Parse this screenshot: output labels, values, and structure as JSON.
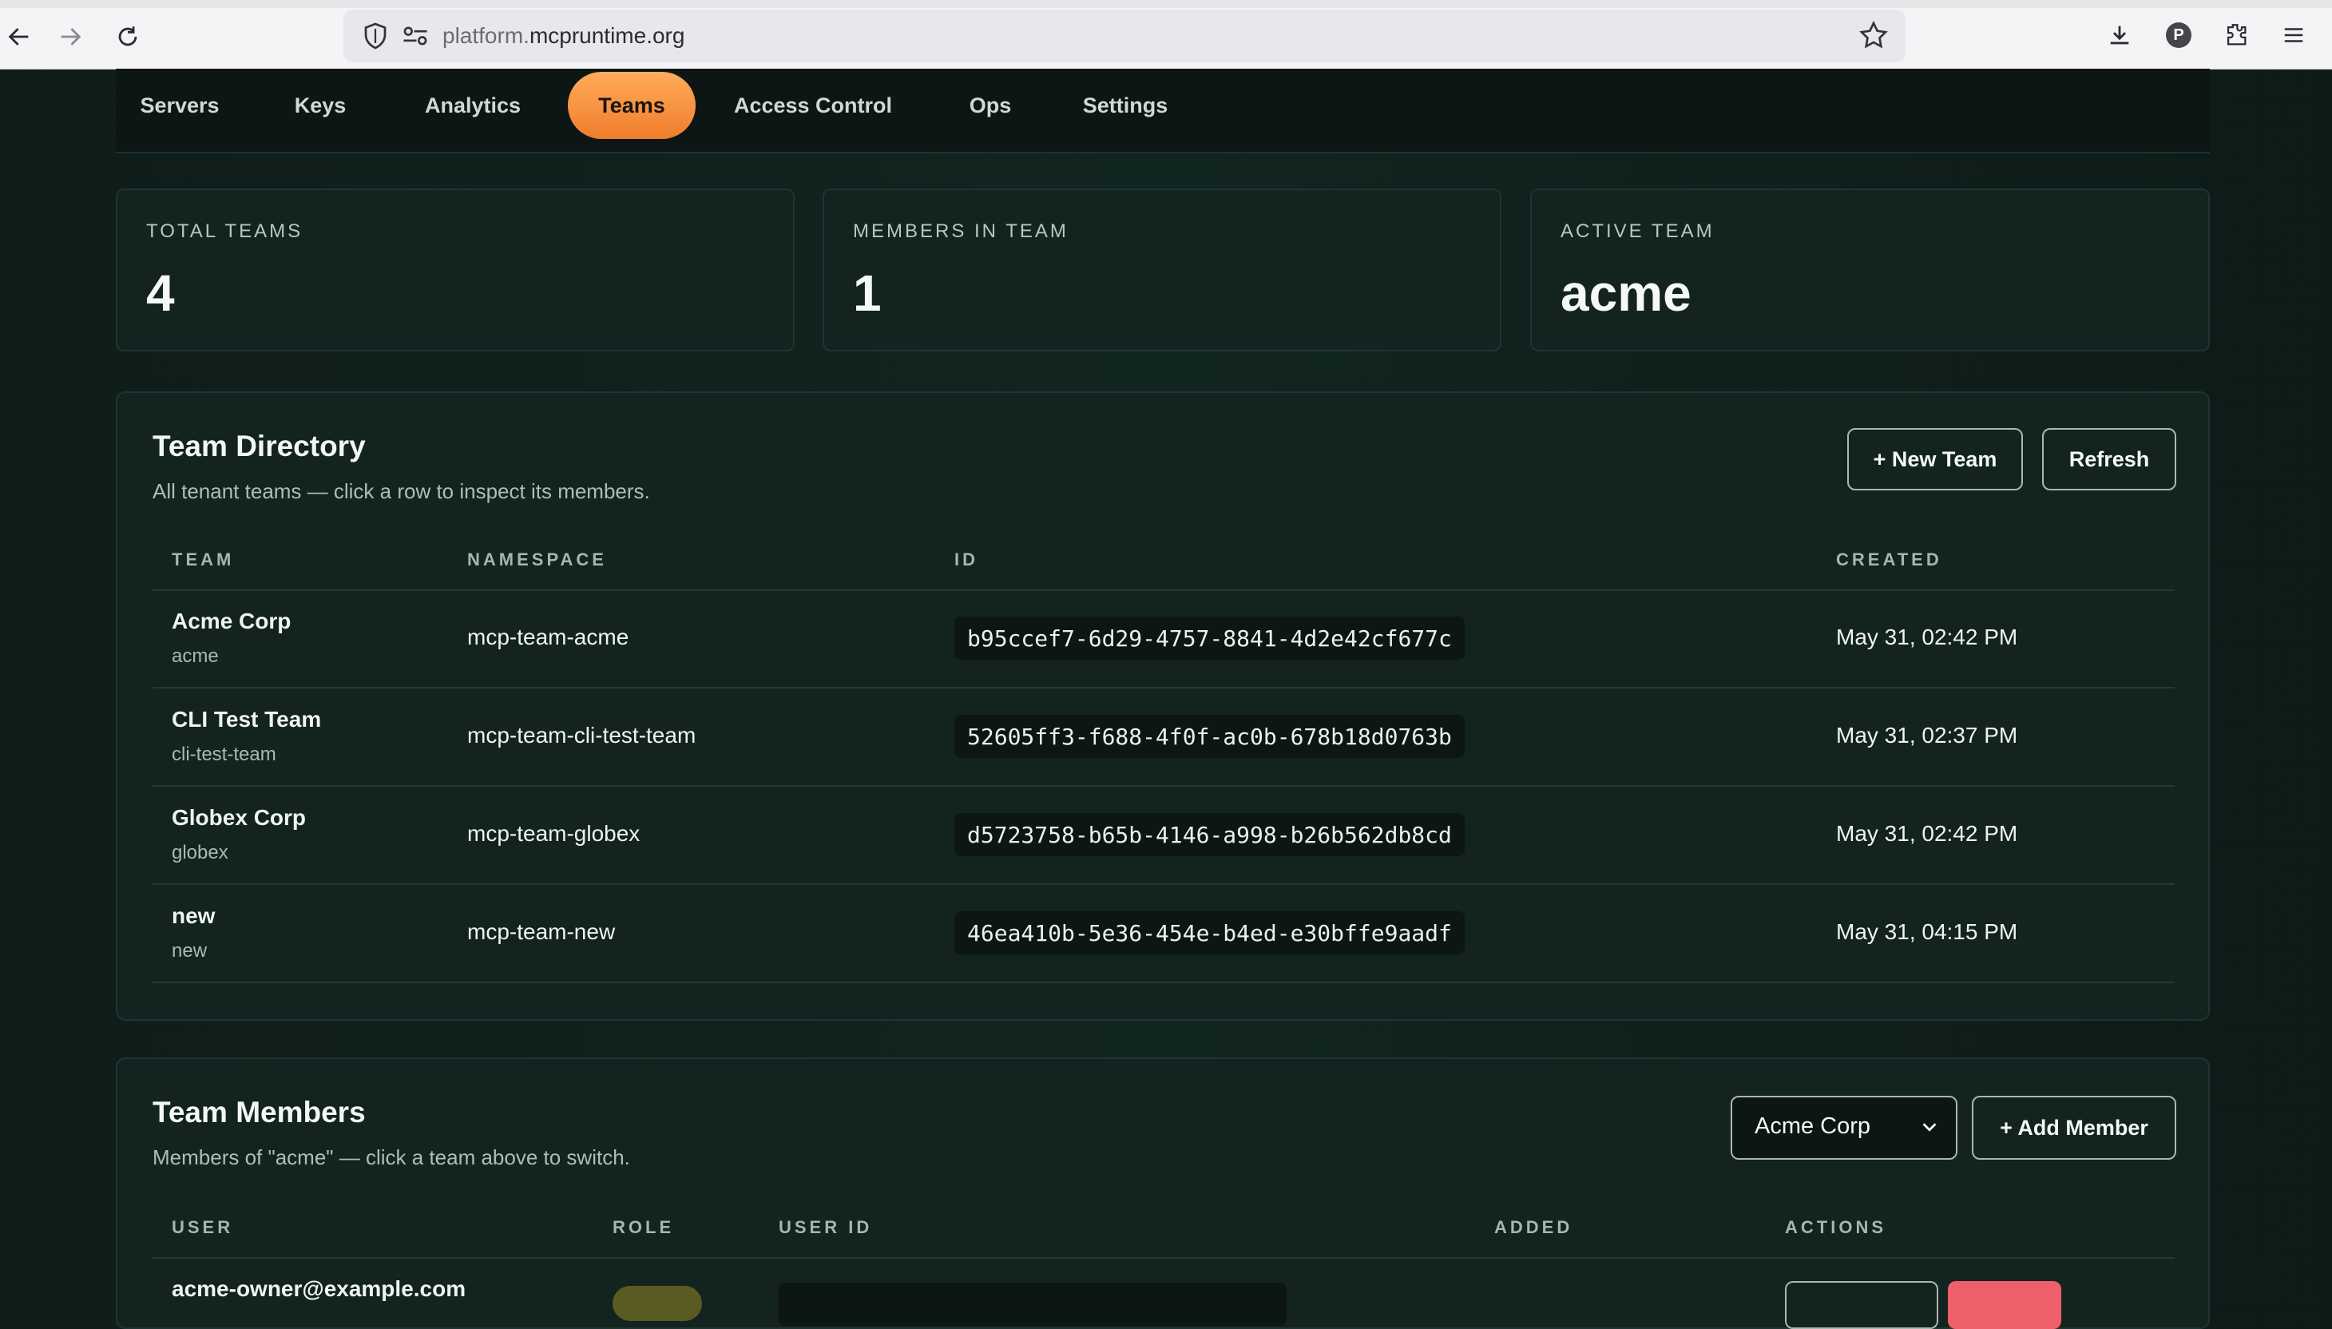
{
  "browser": {
    "url_prefix": "platform.",
    "url_domain": "mcpruntime.org",
    "profile_initial": "P"
  },
  "nav": {
    "tabs": [
      {
        "label": "Servers"
      },
      {
        "label": "Keys"
      },
      {
        "label": "Analytics"
      },
      {
        "label": "Teams",
        "active": true
      },
      {
        "label": "Access Control"
      },
      {
        "label": "Ops"
      },
      {
        "label": "Settings"
      }
    ]
  },
  "stats": [
    {
      "label": "TOTAL TEAMS",
      "value": "4"
    },
    {
      "label": "MEMBERS IN TEAM",
      "value": "1"
    },
    {
      "label": "ACTIVE TEAM",
      "value": "acme"
    }
  ],
  "directory": {
    "title": "Team Directory",
    "subtitle": "All tenant teams — click a row to inspect its members.",
    "new_team_label": "+ New Team",
    "refresh_label": "Refresh",
    "columns": [
      "TEAM",
      "NAMESPACE",
      "ID",
      "CREATED"
    ],
    "rows": [
      {
        "name": "Acme Corp",
        "slug": "acme",
        "namespace": "mcp-team-acme",
        "id": "b95ccef7-6d29-4757-8841-4d2e42cf677c",
        "created": "May 31, 02:42 PM"
      },
      {
        "name": "CLI Test Team",
        "slug": "cli-test-team",
        "namespace": "mcp-team-cli-test-team",
        "id": "52605ff3-f688-4f0f-ac0b-678b18d0763b",
        "created": "May 31, 02:37 PM"
      },
      {
        "name": "Globex Corp",
        "slug": "globex",
        "namespace": "mcp-team-globex",
        "id": "d5723758-b65b-4146-a998-b26b562db8cd",
        "created": "May 31, 02:42 PM"
      },
      {
        "name": "new",
        "slug": "new",
        "namespace": "mcp-team-new",
        "id": "46ea410b-5e36-454e-b4ed-e30bffe9aadf",
        "created": "May 31, 04:15 PM"
      }
    ]
  },
  "members": {
    "title": "Team Members",
    "subtitle": "Members of \"acme\" — click a team above to switch.",
    "selected_team": "Acme Corp",
    "add_member_label": "+ Add Member",
    "columns": [
      "USER",
      "ROLE",
      "USER ID",
      "ADDED",
      "ACTIONS"
    ],
    "rows": [
      {
        "user": "acme-owner@example.com"
      }
    ]
  }
}
